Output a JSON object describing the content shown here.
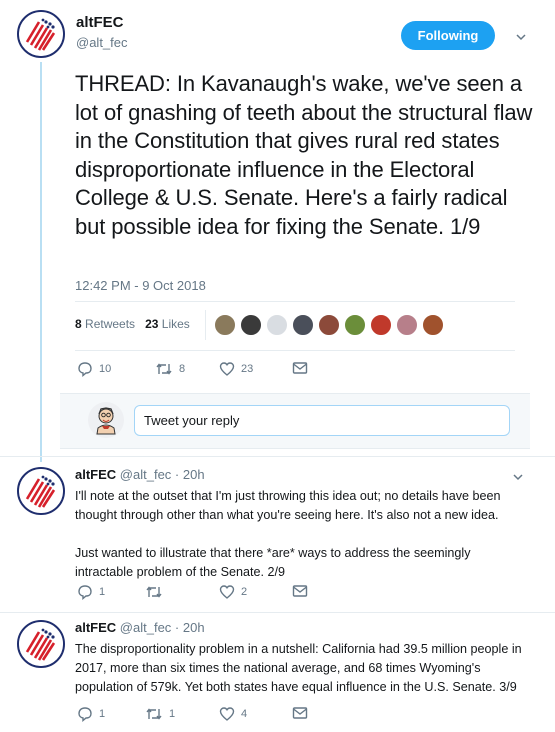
{
  "main_tweet": {
    "author_name": "altFEC",
    "handle": "@alt_fec",
    "follow_label": "Following",
    "text": "THREAD: In Kavanaugh's wake, we've seen a lot of gnashing of teeth about the structural flaw in the Constitution that gives rural red states disproportionate influence in the Electoral College & U.S. Senate. Here's a fairly radical but possible idea for fixing the Senate. 1/9",
    "timestamp": "12:42 PM - 9 Oct 2018",
    "retweets_count": "8",
    "retweets_label": "Retweets",
    "likes_count": "23",
    "likes_label": "Likes",
    "actions": {
      "replies": "10",
      "retweets": "8",
      "likes": "23"
    }
  },
  "reply_box": {
    "placeholder": "Tweet your reply"
  },
  "replies": [
    {
      "author_name": "altFEC",
      "handle": "@alt_fec",
      "time": "20h",
      "paragraphs": [
        "I'll note at the outset that I'm just throwing this idea out; no details have been thought through other than what you're seeing here. It's also not a new idea.",
        "Just wanted to illustrate that there *are* ways to address the seemingly intractable problem of the Senate. 2/9"
      ],
      "actions": {
        "replies": "1",
        "retweets": "",
        "likes": "2"
      }
    },
    {
      "author_name": "altFEC",
      "handle": "@alt_fec",
      "time": "20h",
      "paragraphs": [
        "The disproportionality problem in a nutshell: California had 39.5 million people in 2017, more than six times the national average, and 68 times Wyoming's population of 579k. Yet both states have equal influence in the U.S. Senate. 3/9"
      ],
      "actions": {
        "replies": "1",
        "retweets": "1",
        "likes": "4"
      }
    }
  ],
  "colors": {
    "accent": "#1da1f2",
    "thread_line": "#b9dff3",
    "muted": "#657786",
    "text": "#14171a",
    "logo_red": "#d6202b",
    "logo_blue": "#1f2e6e"
  },
  "icons": [
    "reply-icon",
    "retweet-icon",
    "like-icon",
    "message-icon",
    "chevron-down-icon"
  ]
}
